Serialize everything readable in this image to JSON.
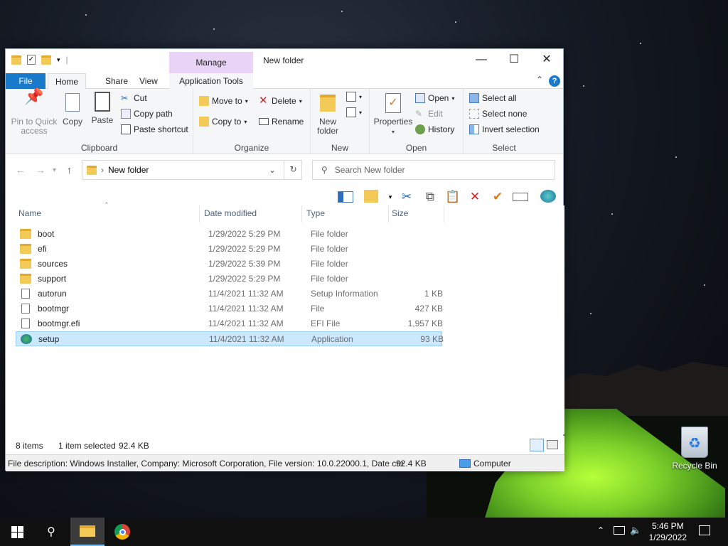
{
  "window": {
    "title": "New folder",
    "manage_label": "Manage",
    "controls": {
      "minimize": "—",
      "maximize": "☐",
      "close": "✕"
    }
  },
  "tabs": [
    "File",
    "Home",
    "Share",
    "View",
    "Application Tools"
  ],
  "ribbon": {
    "clipboard": {
      "label": "Clipboard",
      "pin": "Pin to Quick access",
      "copy": "Copy",
      "paste": "Paste",
      "cut": "Cut",
      "copy_path": "Copy path",
      "paste_shortcut": "Paste shortcut"
    },
    "organize": {
      "label": "Organize",
      "move_to": "Move to",
      "copy_to": "Copy to",
      "delete": "Delete",
      "rename": "Rename"
    },
    "new": {
      "label": "New",
      "new_folder": "New folder"
    },
    "open": {
      "label": "Open",
      "properties": "Properties",
      "open": "Open",
      "edit": "Edit",
      "history": "History"
    },
    "select": {
      "label": "Select",
      "select_all": "Select all",
      "select_none": "Select none",
      "invert": "Invert selection"
    }
  },
  "address": {
    "path": "New folder",
    "search_placeholder": "Search New folder"
  },
  "columns": {
    "name": "Name",
    "date": "Date modified",
    "type": "Type",
    "size": "Size"
  },
  "files": [
    {
      "name": "boot",
      "date": "1/29/2022 5:29 PM",
      "type": "File folder",
      "size": "",
      "icon": "folder"
    },
    {
      "name": "efi",
      "date": "1/29/2022 5:29 PM",
      "type": "File folder",
      "size": "",
      "icon": "folder"
    },
    {
      "name": "sources",
      "date": "1/29/2022 5:39 PM",
      "type": "File folder",
      "size": "",
      "icon": "folder"
    },
    {
      "name": "support",
      "date": "1/29/2022 5:29 PM",
      "type": "File folder",
      "size": "",
      "icon": "folder"
    },
    {
      "name": "autorun",
      "date": "11/4/2021 11:32 AM",
      "type": "Setup Information",
      "size": "1 KB",
      "icon": "file"
    },
    {
      "name": "bootmgr",
      "date": "11/4/2021 11:32 AM",
      "type": "File",
      "size": "427 KB",
      "icon": "file"
    },
    {
      "name": "bootmgr.efi",
      "date": "11/4/2021 11:32 AM",
      "type": "EFI File",
      "size": "1,957 KB",
      "icon": "file"
    },
    {
      "name": "setup",
      "date": "11/4/2021 11:32 AM",
      "type": "Application",
      "size": "93 KB",
      "icon": "app",
      "selected": true
    }
  ],
  "status": {
    "count": "8 items",
    "selected": "1 item selected",
    "size": "92.4 KB"
  },
  "infobar": {
    "description": "File description: Windows Installer, Company: Microsoft Corporation, File version: 10.0.22000.1, Date cre",
    "size": "92.4 KB",
    "location": "Computer"
  },
  "desktop": {
    "recycle_bin": "Recycle Bin"
  },
  "taskbar": {
    "time": "5:46 PM",
    "date": "1/29/2022"
  },
  "colors": {
    "accent": "#1979ca",
    "selection": "#cce8ff",
    "manage_tab": "#e9d3f6"
  }
}
